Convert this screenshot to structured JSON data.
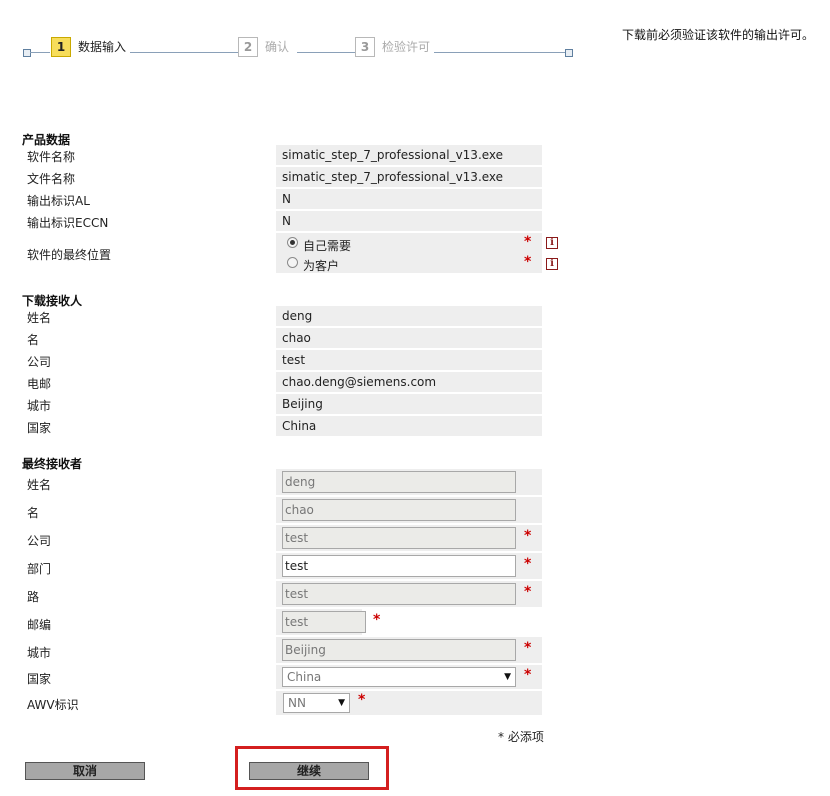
{
  "steps": [
    {
      "number": "1",
      "label": "数据输入",
      "active": true
    },
    {
      "number": "2",
      "label": "确认",
      "active": false
    },
    {
      "number": "3",
      "label": "检验许可",
      "active": false
    }
  ],
  "notice": "下载前必须验证该软件的输出许可。",
  "product": {
    "title": "产品数据",
    "rows": [
      {
        "label": "软件名称",
        "value": "simatic_step_7_professional_v13.exe"
      },
      {
        "label": "文件名称",
        "value": "simatic_step_7_professional_v13.exe"
      },
      {
        "label": "输出标识AL",
        "value": "N"
      },
      {
        "label": "输出标识ECCN",
        "value": "N"
      }
    ],
    "location_label": "软件的最终位置",
    "location_options": [
      "自己需要",
      "为客户"
    ],
    "location_selected": "自己需要"
  },
  "recipient": {
    "title": "下载接收人",
    "rows": [
      {
        "label": "姓名",
        "value": "deng"
      },
      {
        "label": "名",
        "value": "chao"
      },
      {
        "label": "公司",
        "value": "test"
      },
      {
        "label": "电邮",
        "value": "chao.deng@siemens.com"
      },
      {
        "label": "城市",
        "value": "Beijing"
      },
      {
        "label": "国家",
        "value": "China"
      }
    ]
  },
  "end_user": {
    "title": "最终接收者",
    "fields": [
      {
        "label": "姓名",
        "value": "deng"
      },
      {
        "label": "名",
        "value": "chao"
      },
      {
        "label": "公司",
        "value": "test"
      },
      {
        "label": "部门",
        "value": "test"
      },
      {
        "label": "路",
        "value": "test"
      },
      {
        "label": "邮编",
        "value": "test"
      },
      {
        "label": "城市",
        "value": "Beijing"
      }
    ],
    "country_label": "国家",
    "country_value": "China",
    "awv_label": "AWV标识",
    "awv_value": "NN"
  },
  "required_marker": "*",
  "required_note": "* 必添项",
  "buttons": {
    "cancel": "取消",
    "continue": "继续"
  },
  "colors": {
    "accent_step": "#f7dd5b",
    "required": "#cc0000",
    "highlight": "#d41f1f"
  }
}
